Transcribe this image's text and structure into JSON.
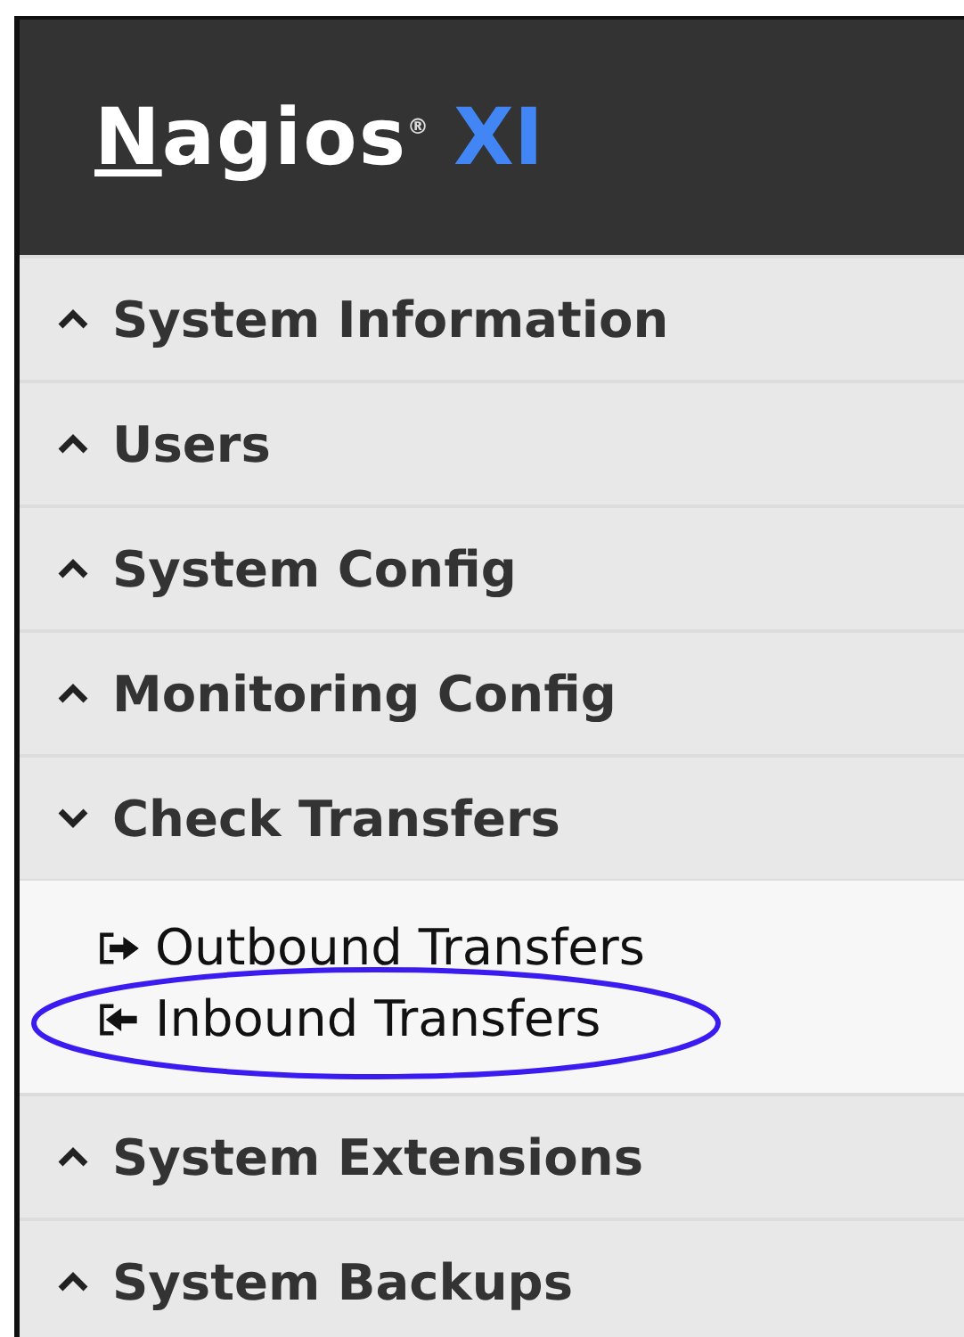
{
  "logo": {
    "name": "Nagios",
    "mark": "®",
    "product": "XI"
  },
  "sections": [
    {
      "label": "System Information",
      "expanded": false
    },
    {
      "label": "Users",
      "expanded": false
    },
    {
      "label": "System Config",
      "expanded": false
    },
    {
      "label": "Monitoring Config",
      "expanded": false
    },
    {
      "label": "Check Transfers",
      "expanded": true,
      "children": [
        {
          "label": "Outbound Transfers",
          "kind": "outbound"
        },
        {
          "label": "Inbound Transfers",
          "kind": "inbound"
        }
      ]
    },
    {
      "label": "System Extensions",
      "expanded": false
    },
    {
      "label": "System Backups",
      "expanded": false
    }
  ]
}
